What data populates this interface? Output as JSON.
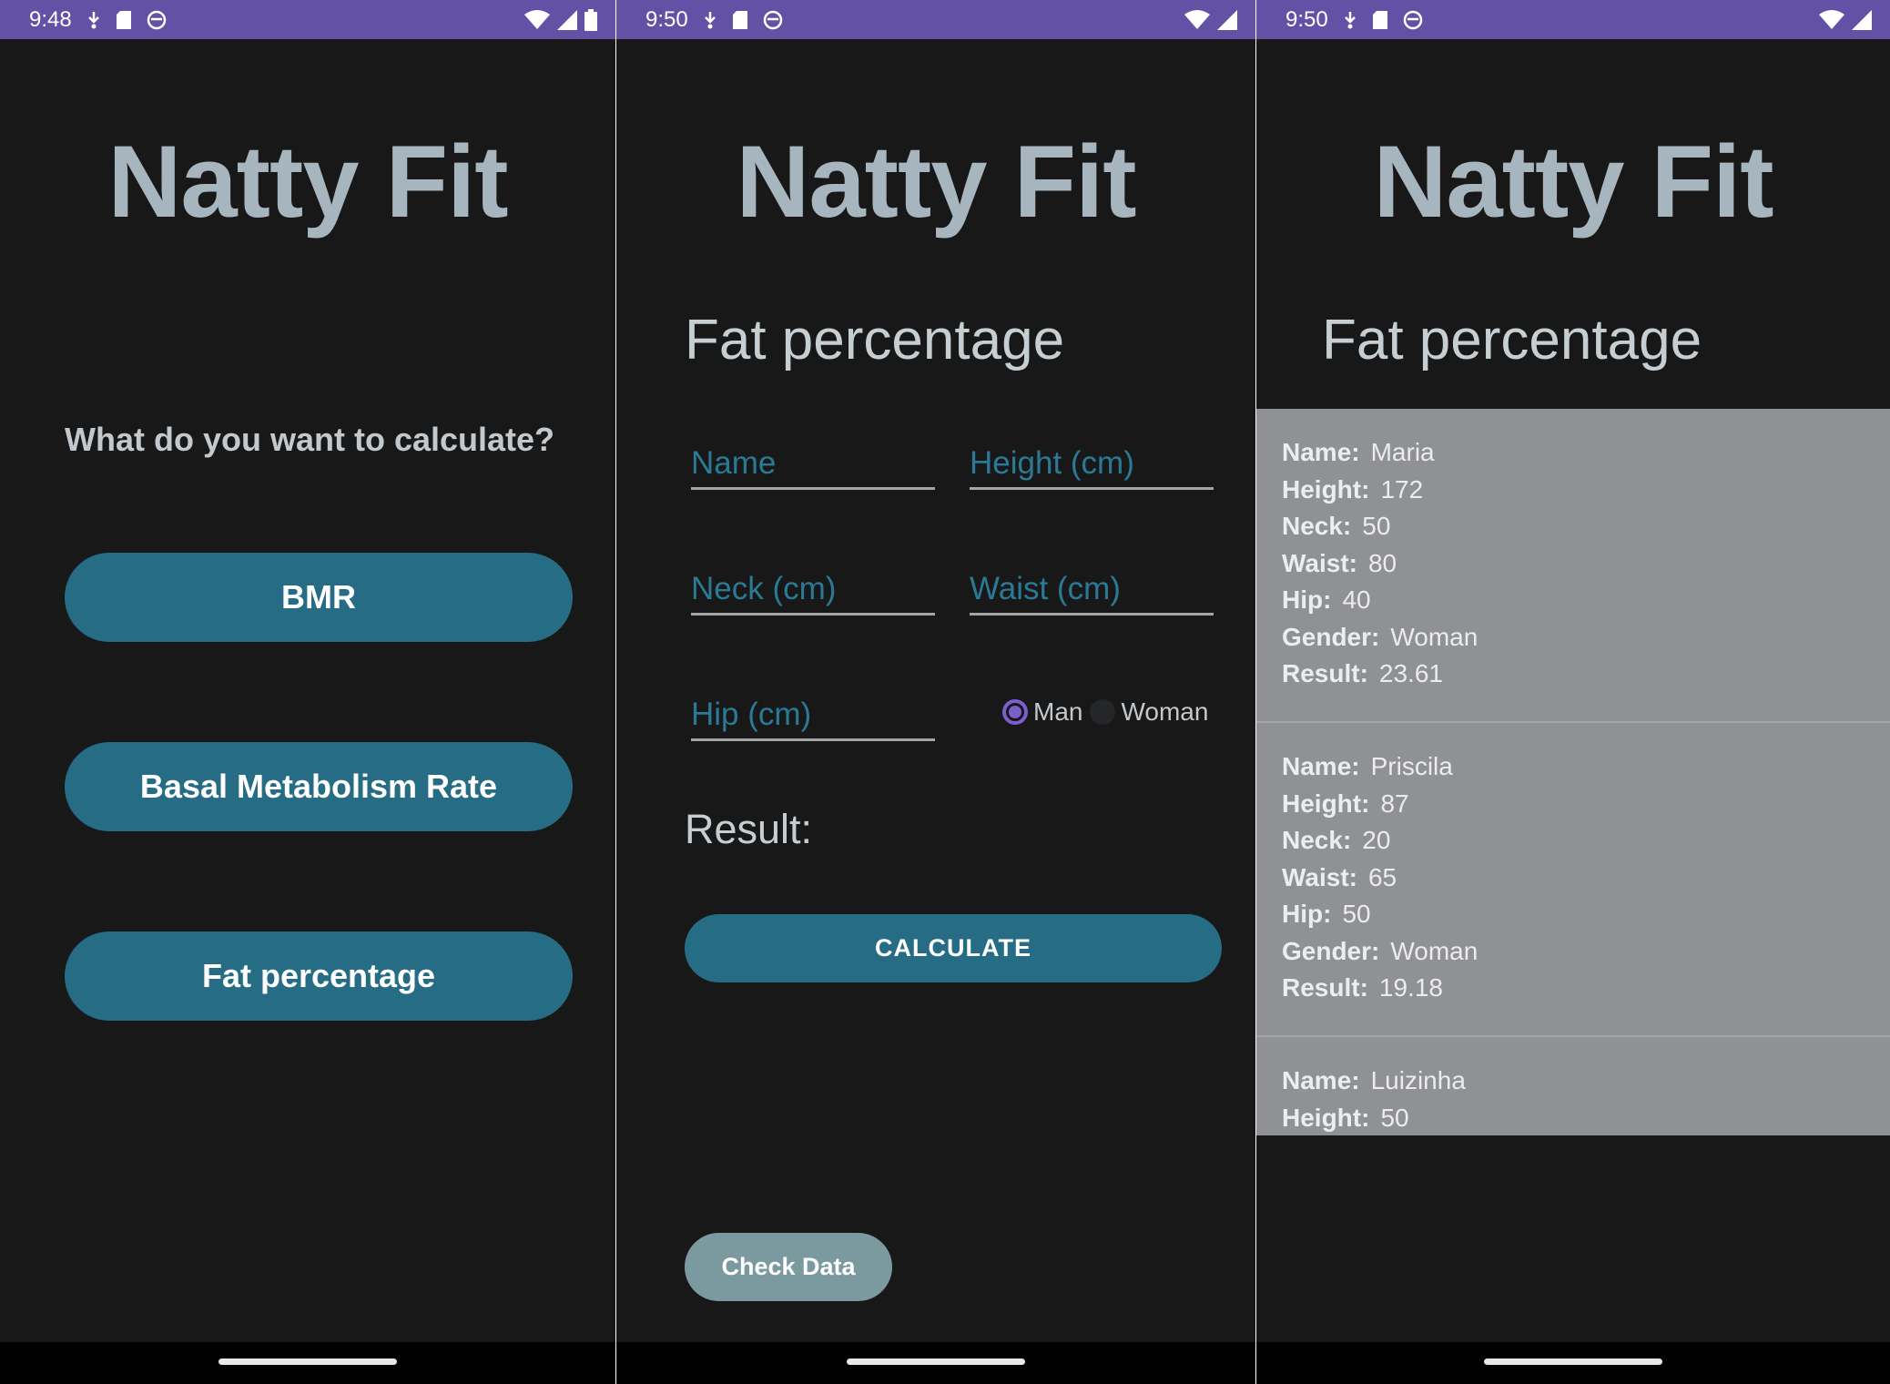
{
  "screens": [
    {
      "status_time": "9:48",
      "app_title": "Natty Fit",
      "question": "What do you want to calculate?",
      "buttons": [
        "BMR",
        "Basal Metabolism Rate",
        "Fat percentage"
      ]
    },
    {
      "status_time": "9:50",
      "app_title": "Natty Fit",
      "heading": "Fat percentage",
      "fields": {
        "name": "Name",
        "height": "Height (cm)",
        "neck": "Neck (cm)",
        "waist": "Waist (cm)",
        "hip": "Hip (cm)"
      },
      "gender_options": [
        "Man",
        "Woman"
      ],
      "gender_selected": "Man",
      "result_label": "Result:",
      "calculate_label": "CALCULATE",
      "check_data_label": "Check Data"
    },
    {
      "status_time": "9:50",
      "app_title": "Natty Fit",
      "heading": "Fat percentage",
      "labels": {
        "name": "Name:",
        "height": "Height:",
        "neck": "Neck:",
        "waist": "Waist:",
        "hip": "Hip:",
        "gender": "Gender:",
        "result": "Result:"
      },
      "records": [
        {
          "name": "Maria",
          "height": "172",
          "neck": "50",
          "waist": "80",
          "hip": "40",
          "gender": "Woman",
          "result": "23.61"
        },
        {
          "name": "Priscila",
          "height": "87",
          "neck": "20",
          "waist": "65",
          "hip": "50",
          "gender": "Woman",
          "result": "19.18"
        },
        {
          "name": "Luizinha",
          "height": "50"
        }
      ]
    }
  ],
  "colors": {
    "status_bar": "#6351a6",
    "background": "#181819",
    "title_text": "#a6b5be",
    "primary_button": "#256c84",
    "secondary_button": "#7b9aa0",
    "input_hint": "#2a7a96",
    "radio_accent": "#7c5fcc",
    "list_background": "#8f9194"
  },
  "icons": {
    "status_left": [
      "download-status-icon",
      "sd-card-icon",
      "sync-face-icon"
    ],
    "status_right": [
      "wifi-icon",
      "cell-signal-icon",
      "battery-icon"
    ]
  }
}
